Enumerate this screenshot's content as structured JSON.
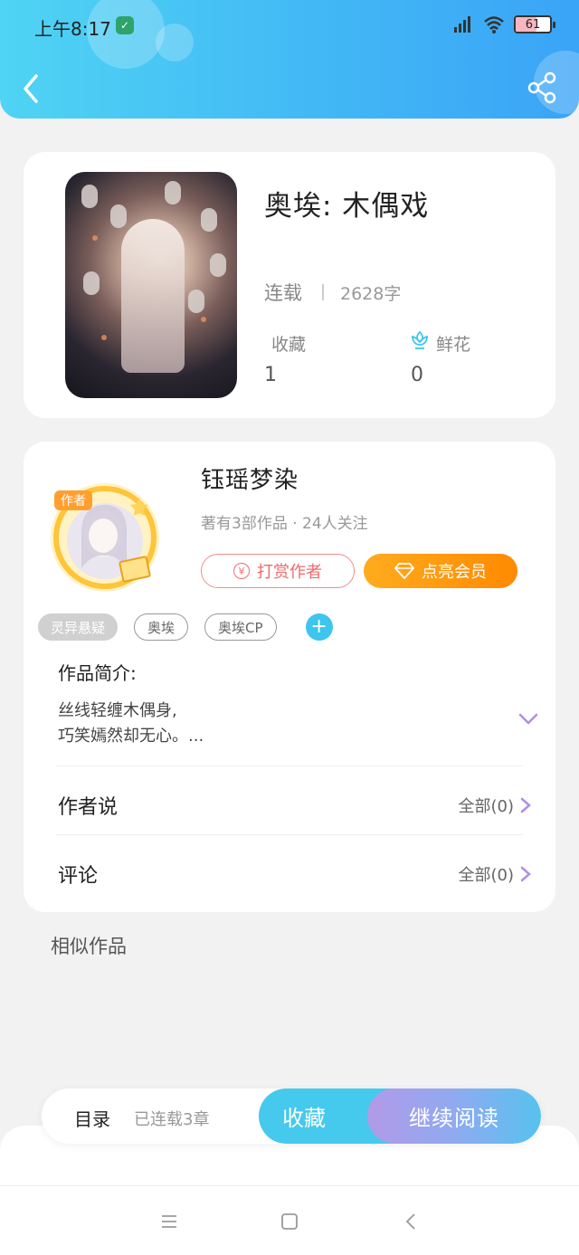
{
  "status_bar": {
    "time": "上午8:17",
    "battery": "61",
    "battery_level": 0.61
  },
  "book": {
    "title": "奥埃: 木偶戏",
    "status": "连载",
    "word_count": "2628字",
    "collect_label": "收藏",
    "collect_value": "1",
    "flower_label": "鲜花",
    "flower_value": "0"
  },
  "author": {
    "avatar_badge": "作者",
    "name": "钰瑶梦染",
    "meta": "著有3部作品 · 24人关注",
    "reward_label": "打赏作者",
    "vip_label": "点亮会员"
  },
  "tags": [
    {
      "label": "灵异悬疑",
      "style": "filled"
    },
    {
      "label": "奥埃",
      "style": "outline"
    },
    {
      "label": "奥埃CP",
      "style": "outline"
    }
  ],
  "intro": {
    "title": "作品简介:",
    "line1": "丝线轻缠木偶身,",
    "line2": "巧笑嫣然却无心。..."
  },
  "author_says": {
    "label": "作者说",
    "right": "全部(0)"
  },
  "comments": {
    "label": "评论",
    "right": "全部(0)"
  },
  "similar": {
    "title": "相似作品"
  },
  "bottom": {
    "toc_label": "目录",
    "toc_sub": "已连载3章",
    "collect": "收藏",
    "read": "继续阅读"
  },
  "colors": {
    "header_start": "#4fd4f4",
    "header_end": "#3aa4f6",
    "accent_cyan": "#45c9ec",
    "vip_orange": "#ff8a00",
    "reward_red": "#ee6b6b",
    "chevron_purple": "#b18fe0"
  },
  "icons": [
    "back-arrow-icon",
    "share-icon",
    "flower-icon",
    "yen-icon",
    "diamond-icon",
    "plus-icon",
    "chevron-down-icon",
    "chevron-right-icon",
    "menu-icon",
    "home-square-icon",
    "nav-back-icon"
  ]
}
